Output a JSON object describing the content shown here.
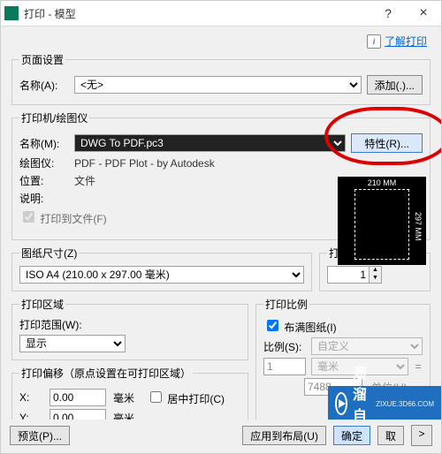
{
  "window": {
    "title": "打印 - 模型"
  },
  "help": {
    "link": "了解打印"
  },
  "pageSetup": {
    "legend": "页面设置",
    "name_label": "名称(A):",
    "name_value": "<无>",
    "add_btn": "添加(.)..."
  },
  "printer": {
    "legend": "打印机/绘图仪",
    "name_label": "名称(M):",
    "name_value": "DWG To PDF.pc3",
    "properties_btn": "特性(R)...",
    "plotter_label": "绘图仪:",
    "plotter_value": "PDF - PDF Plot - by Autodesk",
    "location_label": "位置:",
    "location_value": "文件",
    "desc_label": "说明:",
    "to_file_label": "打印到文件(F)",
    "preview_top": "210 MM",
    "preview_side": "297 MM"
  },
  "paperSize": {
    "legend": "图纸尺寸(Z)",
    "value": "ISO A4 (210.00 x 297.00 毫米)"
  },
  "copies": {
    "legend": "打印份数(B)",
    "value": "1"
  },
  "area": {
    "legend": "打印区域",
    "range_label": "打印范围(W):",
    "range_value": "显示"
  },
  "offset": {
    "legend": "打印偏移（原点设置在可打印区域）",
    "x_label": "X:",
    "x_value": "0.00",
    "y_label": "Y:",
    "y_value": "0.00",
    "unit": "毫米",
    "center_label": "居中打印(C)"
  },
  "scale": {
    "legend": "打印比例",
    "fit_label": "布满图纸(I)",
    "ratio_label": "比例(S):",
    "ratio_value": "自定义",
    "num1": "1",
    "unit_combo": "毫米",
    "eq": "=",
    "num2": "7488",
    "unit_text": "单位(U)"
  },
  "footer": {
    "preview_btn": "预览(P)...",
    "apply_btn": "应用到布局(U)",
    "ok_btn": "确定",
    "cancel_btn": "取"
  },
  "watermark": {
    "text": "溜溜自学",
    "sub": "ZIXUE.3D66.COM"
  }
}
